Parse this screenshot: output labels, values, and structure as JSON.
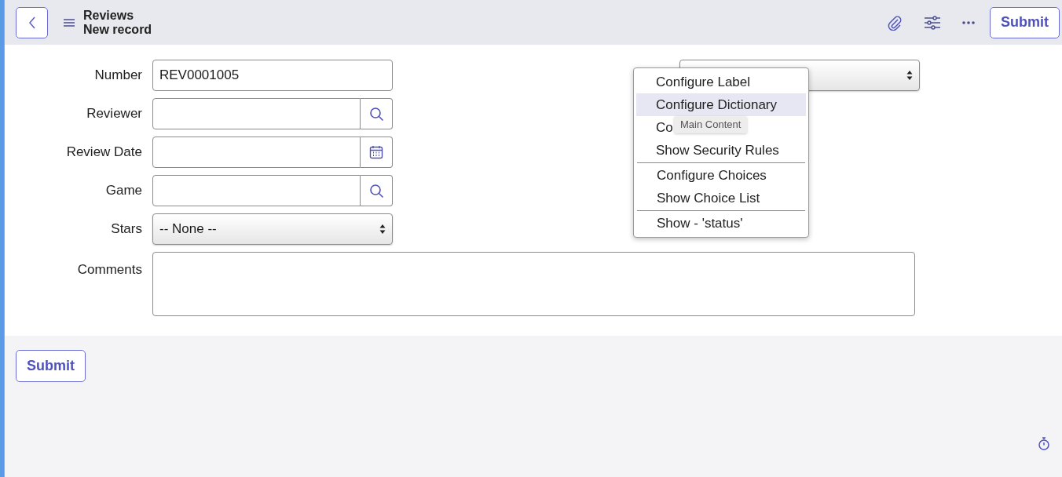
{
  "header": {
    "title": "Reviews",
    "subtitle": "New record",
    "submit": "Submit"
  },
  "fields": [
    {
      "label": "Number",
      "kind": "text",
      "value": "REV0001005"
    },
    {
      "label": "Reviewer",
      "kind": "lookup"
    },
    {
      "label": "Review Date",
      "kind": "date"
    },
    {
      "label": "Game",
      "kind": "lookup"
    },
    {
      "label": "Stars",
      "kind": "select",
      "value": "-- None --"
    }
  ],
  "comments": {
    "label": "Comments"
  },
  "right_field": {
    "kind": "select"
  },
  "context_menu": {
    "groups": [
      [
        {
          "label": "Configure Label",
          "selected": false
        },
        {
          "label": "Configure Dictionary",
          "selected": true
        },
        {
          "label": "Co",
          "selected": false
        },
        {
          "label": "Show Security Rules",
          "selected": false
        }
      ],
      [
        {
          "label": "Configure Choices",
          "selected": false
        },
        {
          "label": "Show Choice List",
          "selected": false
        }
      ],
      [
        {
          "label": "Show - 'status'",
          "selected": false
        }
      ]
    ]
  },
  "tooltip": "Main Content",
  "footer": {
    "submit": "Submit"
  }
}
